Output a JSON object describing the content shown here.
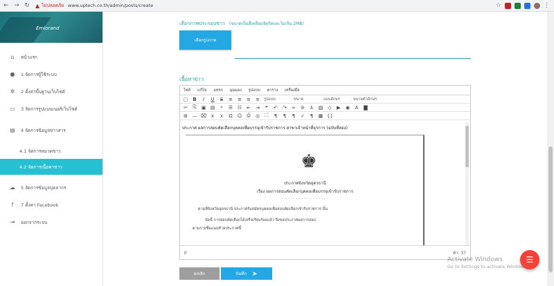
{
  "browser": {
    "insecure_label": "ไม่ปลอดภัย",
    "url": "www.uptech.co.th/admin/posts/create"
  },
  "sidebar": {
    "user_name": "Emiorand",
    "items": [
      {
        "label": "หน้าแรก",
        "icon": "home-icon"
      },
      {
        "label": "1 จัดการผู้ใช้ระบบ",
        "icon": "user-icon"
      },
      {
        "label": "2 ตั้งค่าพื้นฐานเว็บไซต์",
        "icon": "gear-icon"
      },
      {
        "label": "3 จัดการรูปแบนเนอร์เว็บไซต์",
        "icon": "monitor-icon"
      },
      {
        "label": "4 จัดการข้อมูลข่าวสาร",
        "icon": "newspaper-icon"
      }
    ],
    "sub_items": [
      {
        "label": "4.1 จัดการหมวดข่าว"
      },
      {
        "label": "4.2 จัดการเนื้อหาข่าว"
      }
    ],
    "items_after": [
      {
        "label": "5 จัดการข้อมูลบุคลากร",
        "icon": "cloud-icon"
      },
      {
        "label": "7 ตั้งค่า Facebook",
        "icon": "facebook-icon"
      },
      {
        "label": "ออกจากระบบ",
        "icon": "logout-icon"
      }
    ]
  },
  "main": {
    "image_label": "เลือกภาพประกอบข่าว",
    "image_hint": "(ขนาดเป็นสี่เหลี่ยมจัตุรัสและไม่เกิน 2MB)",
    "choose_button": "เลือกรูปภาพ",
    "content_label": "เนื้อหาข่าว",
    "editor": {
      "menu": [
        "ไฟล์",
        "แก้ไข",
        "แทรก",
        "มุมมอง",
        "รูปแบบ",
        "ตาราง",
        "เครื่องมือ"
      ],
      "format_select": "รูปแบบ",
      "size_select": "ขนาด",
      "font_select": "แบบอักษร",
      "font_size_select": "ขนาดตัวอักษร",
      "first_line": "ประกาศ ผลการสอบคัดเลือกบุคคลเพื่อบรรจุเข้ารับราชการ สาขาเจ้าหน้าที่ธุรการ (ฉบับที่สอง)",
      "doc_title_1": "ประกาศจังหวัดอุดรธานี",
      "doc_title_2": "เรื่อง ผลการสอบคัดเลือกบุคคลเพื่อบรรจุเข้ารับราชการ",
      "doc_line_1": "ตามที่จังหวัดอุดรธานี ประกาศรับสมัครบุคคลเพื่อสอบคัดเลือกเข้ารับราชการ นั้น",
      "doc_line_2": "บัดนี้ การสอบคัดเลือกได้เสร็จเรียบร้อยแล้ว จึงขอประกาศผลการสอบ",
      "doc_line_3": "ตามรายชื่อแนบท้ายประกาศนี้",
      "status_path": "p",
      "word_count": "คำ: 37"
    },
    "cancel_button": "ยกเลิก",
    "save_button": "บันทึก"
  },
  "watermark": {
    "title": "Activate Windows",
    "subtitle": "Go to Settings to activate Windows."
  },
  "colors": {
    "accent": "#26c0d2",
    "button_blue": "#24a8e4",
    "fab": "#f44336"
  }
}
